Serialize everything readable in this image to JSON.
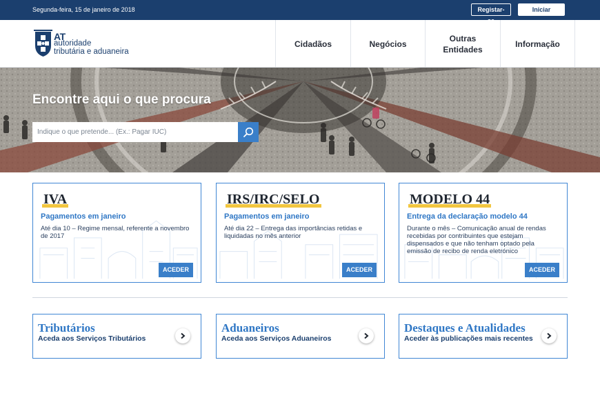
{
  "topbar": {
    "date": "Segunda-feira, 15 de janeiro de 2018",
    "register": "Registar-se",
    "login": "Iniciar Sessão"
  },
  "logo": {
    "at": "AT",
    "line1": "autoridade",
    "line2": "tributária e aduaneira"
  },
  "nav": {
    "item1": "Cidadãos",
    "item2": "Negócios",
    "item3_line1": "Outras",
    "item3_line2": "Entidades",
    "item4": "Informação"
  },
  "hero": {
    "title": "Encontre aqui o que procura",
    "search_placeholder": "Indique o que pretende... (Ex.: Pagar IUC)",
    "search_icon": "search-icon"
  },
  "cards": [
    {
      "title": "IVA",
      "subtitle": "Pagamentos em janeiro",
      "text": "Até dia 10 – Regime mensal, referente a novembro de 2017",
      "button": "ACEDER"
    },
    {
      "title": "IRS/IRC/SELO",
      "subtitle": "Pagamentos em janeiro",
      "text": "Até dia 22 – Entrega das importâncias retidas e liquidadas no mês anterior",
      "button": "ACEDER"
    },
    {
      "title": "MODELO 44",
      "subtitle": "Entrega da declaração modelo 44",
      "text": "Durante o mês – Comunicação anual de rendas recebidas por contribuintes que estejam dispensados e que não tenham optado pela emissão de recibo de renda eletrónico",
      "button": "ACEDER"
    }
  ],
  "links": [
    {
      "title": "Tributários",
      "subtitle": "Aceda aos Serviços Tributários"
    },
    {
      "title": "Aduaneiros",
      "subtitle": "Aceda aos Serviços Aduaneiros"
    },
    {
      "title": "Destaques e Atualidades",
      "subtitle": "Aceder às publicações mais recentes"
    }
  ],
  "colors": {
    "topbar": "#1b3f6e",
    "accent": "#3a7fc9",
    "card_border": "#3f86d4",
    "title_underline": "#f2c63f"
  }
}
